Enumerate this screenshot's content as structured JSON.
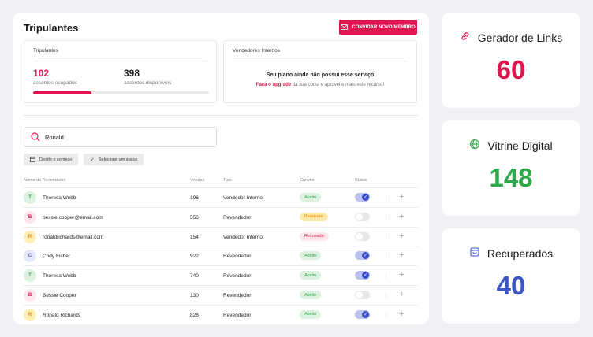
{
  "main": {
    "title": "Tripulantes",
    "invite_button": "CONVIDAR NOVO MEMBRO",
    "seats": {
      "title": "Tripulantes",
      "occupied": "102",
      "occupied_label": "assentos ocupados",
      "available": "398",
      "available_label": "assentos disponíveis",
      "progress_fraction": 0.33
    },
    "internal": {
      "title": "Vendedores Internos",
      "message": "Seu plano ainda não possui esse serviço",
      "link": "Faça o upgrade",
      "rest": " da sua conta e aproveite mais este recurso!"
    },
    "search": {
      "value": "Ronald"
    },
    "filters": {
      "date": "Desde o começo",
      "status": "Selecione um status"
    },
    "columns": [
      "Nome do Revendedor",
      "Vendas",
      "Tipo",
      "Convite",
      "Status"
    ],
    "rows": [
      {
        "initial": "T",
        "name": "Theresa Webb",
        "sales": "196",
        "type": "Vendedor Interno",
        "invite": "Aceito",
        "active": true,
        "color": "green"
      },
      {
        "initial": "B",
        "name": "bessie.cooper@email.com",
        "sales": "556",
        "type": "Revendedor",
        "invite": "Pendente",
        "active": false,
        "color": "pink"
      },
      {
        "initial": "R",
        "name": "ronaldrichards@email.com",
        "sales": "154",
        "type": "Vendedor Interno",
        "invite": "Recusado",
        "active": false,
        "color": "yellow"
      },
      {
        "initial": "C",
        "name": "Cody Fisher",
        "sales": "922",
        "type": "Revendedor",
        "invite": "Aceito",
        "active": true,
        "color": "blue"
      },
      {
        "initial": "T",
        "name": "Theresa Webb",
        "sales": "740",
        "type": "Revendedor",
        "invite": "Aceito",
        "active": true,
        "color": "green"
      },
      {
        "initial": "B",
        "name": "Bessie Cooper",
        "sales": "130",
        "type": "Revendedor",
        "invite": "Aceito",
        "active": false,
        "color": "pink"
      },
      {
        "initial": "R",
        "name": "Ronald Richards",
        "sales": "826",
        "type": "Revendedor",
        "invite": "Aceito",
        "active": true,
        "color": "yellow"
      }
    ]
  },
  "stats": [
    {
      "label": "Gerador de Links",
      "value": "60",
      "color": "#e0174f",
      "icon": "link-icon"
    },
    {
      "label": "Vitrine Digital",
      "value": "148",
      "color": "#2ea94a",
      "icon": "globe-icon"
    },
    {
      "label": "Recuperados",
      "value": "40",
      "color": "#3b55c4",
      "icon": "bag-icon"
    }
  ]
}
